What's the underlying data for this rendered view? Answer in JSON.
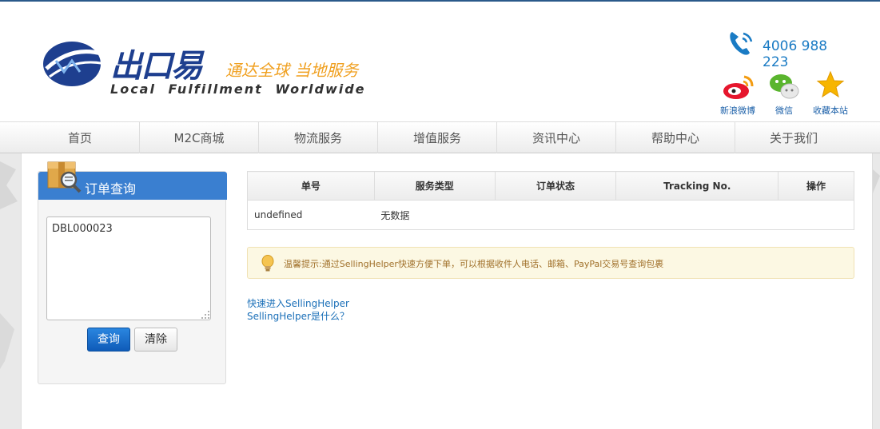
{
  "header": {
    "logo_cn": "出口易",
    "logo_slogan": "通达全球 当地服务",
    "logo_en": "Local Fulfillment Worldwide",
    "phone": "4006 988 223",
    "socials": [
      {
        "label": "新浪微博",
        "icon": "weibo-icon"
      },
      {
        "label": "微信",
        "icon": "wechat-icon"
      },
      {
        "label": "收藏本站",
        "icon": "star-icon"
      }
    ]
  },
  "nav": {
    "items": [
      "首页",
      "M2C商城",
      "物流服务",
      "增值服务",
      "资讯中心",
      "帮助中心",
      "关于我们"
    ]
  },
  "query_panel": {
    "title": "订单查询",
    "input_value": "DBL000023",
    "query_label": "查询",
    "clear_label": "清除"
  },
  "results": {
    "headers": [
      "单号",
      "服务类型",
      "订单状态",
      "Tracking No.",
      "操作"
    ],
    "row": {
      "order_no": "undefined",
      "status": "无数据"
    }
  },
  "tip": {
    "text": "温馨提示:通过SellingHelper快速方便下单，可以根据收件人电话、邮箱、PayPal交易号查询包裹"
  },
  "links": {
    "enter": "快速进入SellingHelper",
    "what": "SellingHelper是什么？"
  },
  "colors": {
    "brand_blue": "#1e3f8f",
    "accent_orange": "#f0a020",
    "panel_header": "#3a7fd0",
    "no_data": "#c00000"
  }
}
